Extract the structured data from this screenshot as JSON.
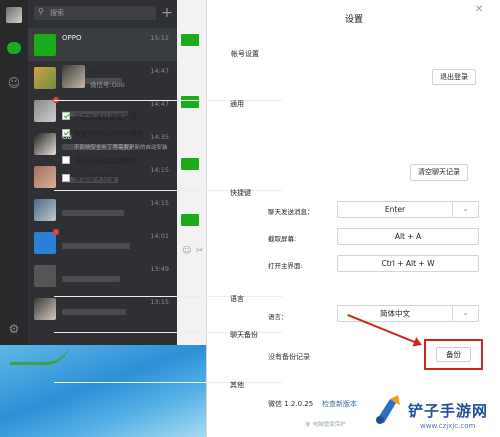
{
  "sidebar": {
    "icons": [
      "avatar",
      "chat-icon",
      "contacts-icon",
      "gear-icon"
    ]
  },
  "chatlist": {
    "search_placeholder": "搜索",
    "add_label": "+",
    "rows": [
      {
        "name": "OPPO",
        "time": "15:12"
      },
      {
        "name": "",
        "time": "14:47"
      },
      {
        "name": "",
        "time": "14:47"
      },
      {
        "name": "Gu",
        "time": "14:35"
      },
      {
        "name": "",
        "time": "14:15"
      },
      {
        "name": "",
        "time": "14:15"
      },
      {
        "name": "",
        "time": "14:01"
      },
      {
        "name": "",
        "time": "13:49"
      },
      {
        "name": "",
        "time": "13:15"
      }
    ]
  },
  "settings": {
    "title": "设置",
    "account": {
      "section": "帐号设置",
      "name": "G",
      "wechat_id": "微信号:Goo",
      "logout": "退出登录"
    },
    "general": {
      "section": "通用",
      "opt_sound": "开启新消息提醒声音",
      "opt_update": "有更新时自动升级微信",
      "update_note": "不影响安全补丁等需要更新的自动安装",
      "opt_autostart": "开机时自动启动微信",
      "opt_keep_history": "保留聊天记录",
      "clear_history": "清空聊天记录"
    },
    "shortcuts": {
      "section": "快捷键",
      "send_label": "聊天发送消息：",
      "send_value": "Enter",
      "screenshot_label": "截取屏幕:",
      "screenshot_value": "Alt + A",
      "open_label": "打开主界面:",
      "open_value": "Ctrl + Alt + W"
    },
    "language": {
      "section": "语言",
      "label": "语言：",
      "value": "简体中文"
    },
    "backup": {
      "section": "聊天备份",
      "status": "没有备份记录",
      "button": "备份"
    },
    "other": {
      "section": "其他",
      "version": "微信 1.2.0.25",
      "check_update": "检查新版本",
      "guard": "电脑管家保护"
    }
  },
  "watermark": {
    "title": "铲子手游网",
    "url": "www.czjxjc.com"
  }
}
